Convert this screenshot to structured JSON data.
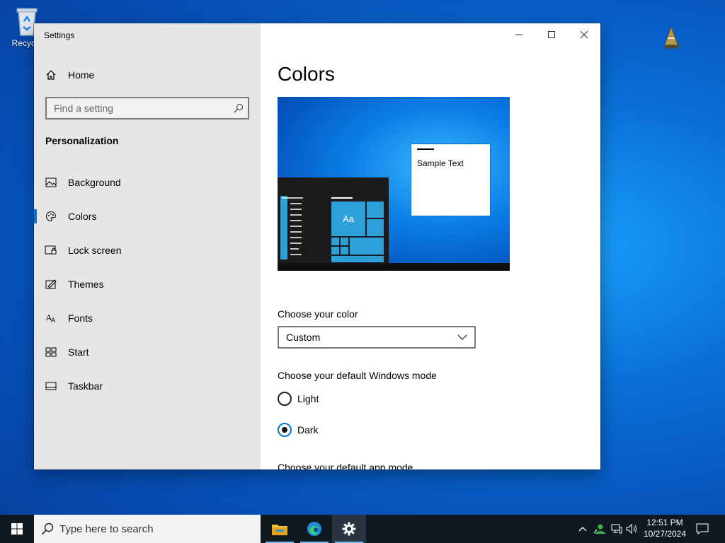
{
  "desktop": {
    "recycle_bin_label": "Recycle"
  },
  "window": {
    "title": "Settings",
    "minimize_glyph": "—",
    "maximize_glyph": "☐",
    "close_glyph": "✕"
  },
  "sidebar": {
    "home_label": "Home",
    "search_placeholder": "Find a setting",
    "section_title": "Personalization",
    "items": [
      {
        "label": "Background",
        "icon": "image-icon"
      },
      {
        "label": "Colors",
        "icon": "palette-icon",
        "selected": true
      },
      {
        "label": "Lock screen",
        "icon": "lock-screen-icon"
      },
      {
        "label": "Themes",
        "icon": "themes-icon"
      },
      {
        "label": "Fonts",
        "icon": "fonts-icon"
      },
      {
        "label": "Start",
        "icon": "start-icon"
      },
      {
        "label": "Taskbar",
        "icon": "taskbar-icon"
      }
    ]
  },
  "main": {
    "title": "Colors",
    "preview": {
      "tile_label": "Aa",
      "sample_text": "Sample Text"
    },
    "choose_color_label": "Choose your color",
    "choose_color_value": "Custom",
    "windows_mode_label": "Choose your default Windows mode",
    "windows_mode_options": [
      {
        "label": "Light",
        "checked": false
      },
      {
        "label": "Dark",
        "checked": true
      }
    ],
    "app_mode_label": "Choose your default app mode"
  },
  "taskbar": {
    "search_placeholder": "Type here to search",
    "clock_time": "12:51 PM",
    "clock_date": "10/27/2024"
  },
  "colors": {
    "accent": "#0078d7",
    "sidebar_bg": "#e6e6e6",
    "taskbar_bg": "#101820"
  }
}
